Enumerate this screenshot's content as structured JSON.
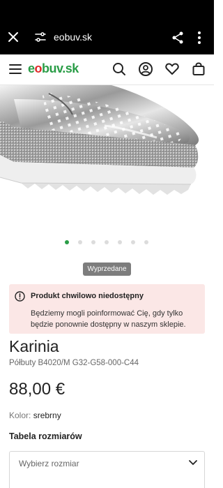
{
  "browser": {
    "url": "eobuv.sk",
    "icons": [
      "close-icon",
      "tune-icon",
      "share-icon",
      "more-vert-icon"
    ]
  },
  "header": {
    "logo": {
      "e": "e",
      "o": "o",
      "rest": "buv",
      "dot": ".sk"
    },
    "icons": [
      "menu-icon",
      "search-icon",
      "account-icon",
      "heart-icon",
      "cart-icon"
    ]
  },
  "carousel": {
    "count": 7,
    "active": 0
  },
  "badge": "Wyprzedane",
  "alert": {
    "title": "Produkt chwilowo niedostępny",
    "text": "Będziemy mogli poinformować Cię, gdy tylko będzie ponownie dostępny w naszym sklepie."
  },
  "product": {
    "brand": "Karinia",
    "model": "Półbuty B4020/M G32-G58-000-C44",
    "price": "88,00 €",
    "color_label": "Kolor:",
    "color_value": "srebrny",
    "size_table_title": "Tabela rozmiarów",
    "size_select_partial": "Wybierz rozmiar"
  },
  "colors": {
    "brand_green": "#2a9d47",
    "brand_red": "#e02b2b",
    "alert_bg": "#fbe7e6",
    "badge_bg": "#7d7d7d"
  }
}
